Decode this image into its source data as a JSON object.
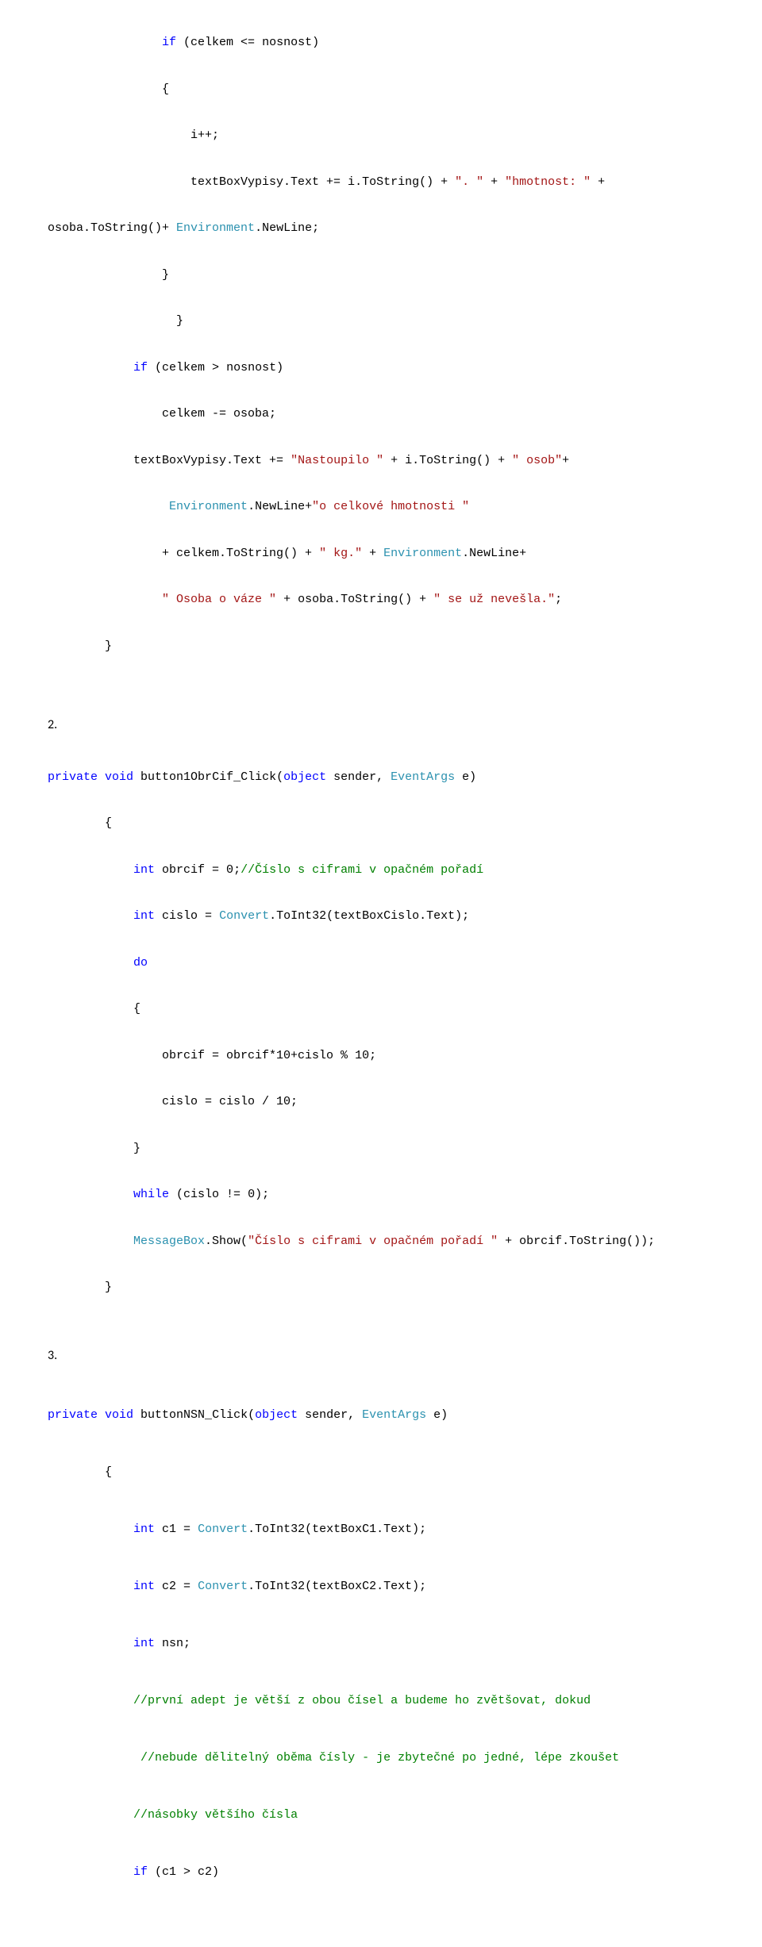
{
  "block1": {
    "l1": {
      "a": "                ",
      "kw": "if",
      "b": " (celkem <= nosnost)"
    },
    "l2": "                {",
    "l3": "                    i++;",
    "l4": {
      "a": "                    textBoxVypisy.Text += i.ToString() + ",
      "s1": "\". \"",
      "b": " + ",
      "s2": "\"hmotnost: \"",
      "c": " + "
    },
    "l5": {
      "a": "osoba.ToString()+ ",
      "t": "Environment",
      "b": ".NewLine;"
    },
    "l6": "                }",
    "l7": "                  }",
    "l8": {
      "a": "            ",
      "kw": "if",
      "b": " (celkem > nosnost)"
    },
    "l9": "                celkem -= osoba;",
    "l10": {
      "a": "            textBoxVypisy.Text += ",
      "s1": "\"Nastoupilo \"",
      "b": " + i.ToString() + ",
      "s2": "\" osob\"",
      "c": "+"
    },
    "l11": {
      "a": "                 ",
      "t": "Environment",
      "b": ".NewLine+",
      "s": "\"o celkové hmotnosti \""
    },
    "l12": {
      "a": "                + celkem.ToString() + ",
      "s": "\" kg.\"",
      "b": " + ",
      "t": "Environment",
      "c": ".NewLine+"
    },
    "l13": {
      "a": "                ",
      "s1": "\" Osoba o váze \"",
      "b": " + osoba.ToString() + ",
      "s2": "\" se už nevešla.\"",
      "c": ";"
    },
    "l14": "        }"
  },
  "label2": "2.",
  "block2": {
    "l1": {
      "kw1": "private",
      "sp1": " ",
      "kw2": "void",
      "b": " button1ObrCif_Click(",
      "kw3": "object",
      "c": " sender, ",
      "t": "EventArgs",
      "d": " e)"
    },
    "l2": "        {",
    "l3": {
      "a": "            ",
      "kw": "int",
      "b": " obrcif = 0;",
      "cmt": "//Číslo s ciframi v opačném pořadí"
    },
    "l4": {
      "a": "            ",
      "kw": "int",
      "b": " cislo = ",
      "t": "Convert",
      "c": ".ToInt32(textBoxCislo.Text);"
    },
    "l5": {
      "a": "            ",
      "kw": "do"
    },
    "l6": "            {",
    "l7": "                obrcif = obrcif*10+cislo % 10;",
    "l8": "                cislo = cislo / 10;",
    "l9": "            }",
    "l10": {
      "a": "            ",
      "kw": "while",
      "b": " (cislo != 0);"
    },
    "l11": {
      "a": "            ",
      "t": "MessageBox",
      "b": ".Show(",
      "s": "\"Číslo s ciframi v opačném pořadí \"",
      "c": " + obrcif.ToString());"
    },
    "l12": "        }"
  },
  "label3": "3.",
  "block3": {
    "l1": {
      "kw1": "private",
      "sp1": " ",
      "kw2": "void",
      "b": " buttonNSN_Click(",
      "kw3": "object",
      "c": " sender, ",
      "t": "EventArgs",
      "d": " e)"
    },
    "l2": "        {",
    "l3": {
      "a": "            ",
      "kw": "int",
      "b": " c1 = ",
      "t": "Convert",
      "c": ".ToInt32(textBoxC1.Text);"
    },
    "l4": {
      "a": "            ",
      "kw": "int",
      "b": " c2 = ",
      "t": "Convert",
      "c": ".ToInt32(textBoxC2.Text);"
    },
    "l5": {
      "a": "            ",
      "kw": "int",
      "b": " nsn;"
    },
    "l6": {
      "a": "            ",
      "cmt": "//první adept je větší z obou čísel a budeme ho zvětšovat, dokud"
    },
    "l7": {
      "a": "             ",
      "cmt": "//nebude dělitelný oběma čísly - je zbytečné po jedné, lépe zkoušet"
    },
    "l8": {
      "a": "            ",
      "cmt": "//násobky většího čísla"
    },
    "l9": {
      "a": "            ",
      "kw": "if",
      "b": " (c1 > c2)"
    }
  }
}
